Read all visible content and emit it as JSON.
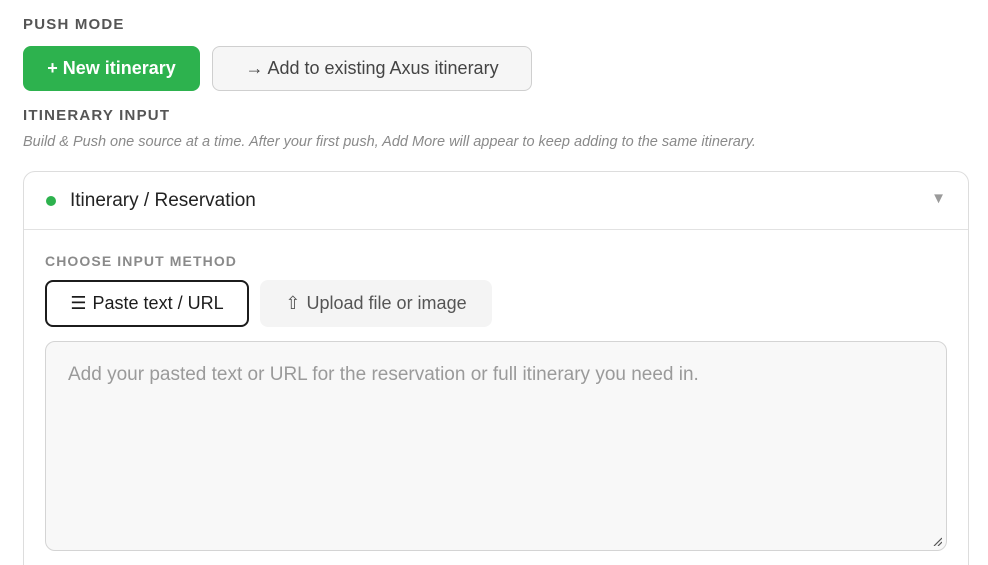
{
  "push_mode": {
    "label": "PUSH MODE",
    "new_itinerary_label": "+ New itinerary",
    "add_existing_label": "→ Add to existing Axus itinerary",
    "selected": "new_itinerary",
    "colors": {
      "primary": "#2db24e"
    }
  },
  "itinerary_input": {
    "label": "ITINERARY INPUT",
    "helper": "Build & Push one source at a time. After your first push, Add More will appear to keep adding to the same itinerary."
  },
  "card": {
    "title": "Itinerary / Reservation",
    "status_color": "#2db24e",
    "chevron_icon": "chevron-down-icon",
    "chevron_glyph": "▼",
    "expanded": true,
    "method_label": "CHOOSE INPUT METHOD",
    "methods": [
      {
        "icon": "☰",
        "label": "Paste text / URL",
        "active": true
      },
      {
        "icon": "⇧",
        "label": "Upload file or image",
        "active": false
      }
    ],
    "textarea": {
      "value": "",
      "placeholder": "Add your pasted text or URL for the reservation or full itinerary you need in."
    }
  }
}
